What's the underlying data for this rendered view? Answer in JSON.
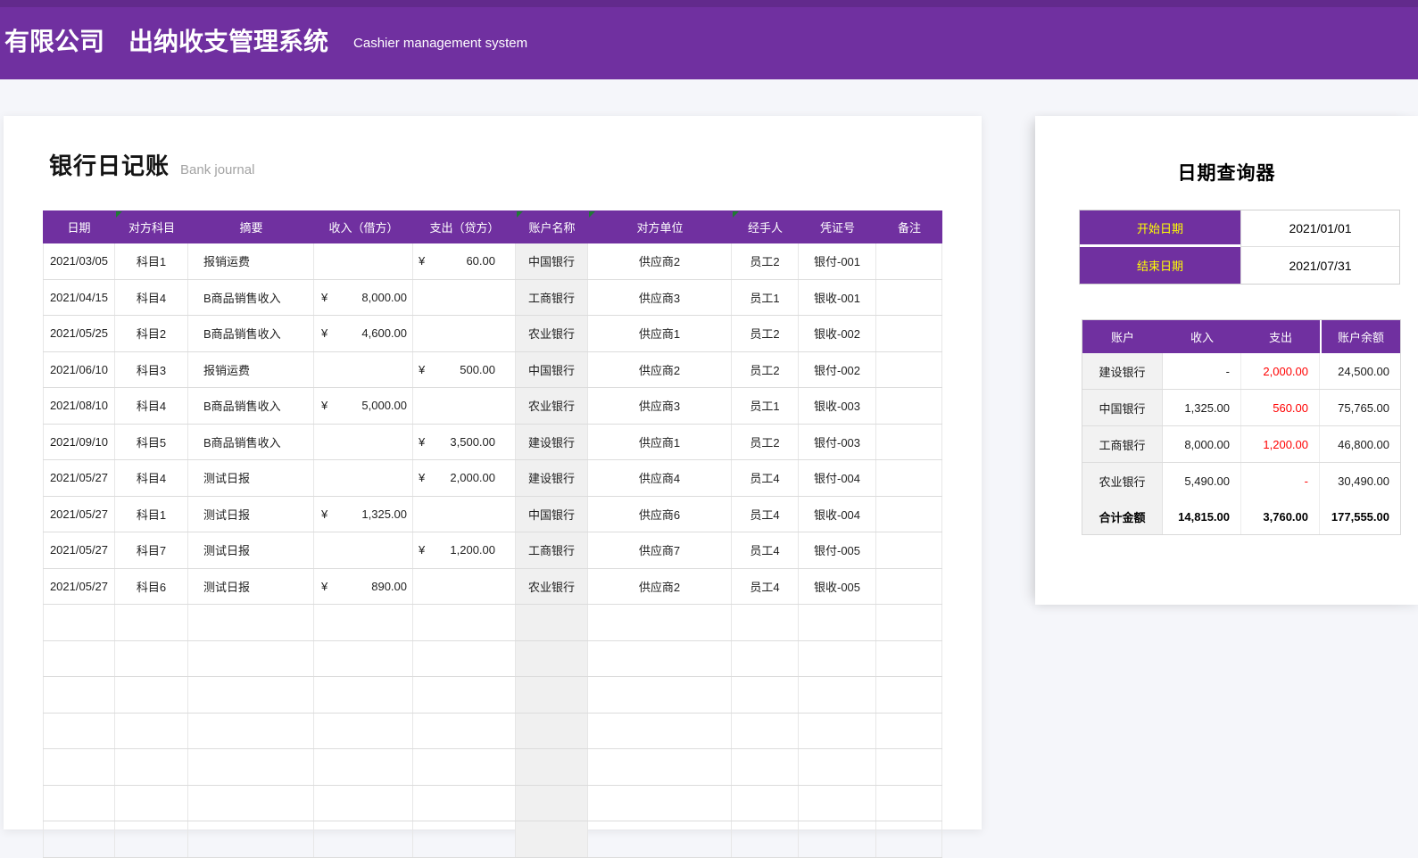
{
  "banner": {
    "company": "有限公司",
    "title": "出纳收支管理系统",
    "subtitle": "Cashier management system"
  },
  "colors": {
    "accent_purple": "#7030A0",
    "label_yellow": "#FFFF00",
    "expense_red": "#FF0000",
    "account_column_gray": "#F0F0F0",
    "page_background": "#F5F6FA"
  },
  "journal": {
    "title": "银行日记账",
    "subtitle": "Bank journal",
    "currency_symbol": "¥",
    "columns": [
      "日期",
      "对方科目",
      "摘要",
      "收入（借方）",
      "支出（贷方）",
      "账户名称",
      "对方单位",
      "经手人",
      "凭证号",
      "备注"
    ],
    "comment_marker_columns": [
      1,
      5,
      6,
      7
    ],
    "rows": [
      {
        "date": "2021/03/05",
        "subject": "科目1",
        "summary": "报销运费",
        "income": "",
        "expense": "60.00",
        "account": "中国银行",
        "counterparty": "供应商2",
        "handler": "员工2",
        "voucher": "银付-001",
        "note": ""
      },
      {
        "date": "2021/04/15",
        "subject": "科目4",
        "summary": "B商品销售收入",
        "income": "8,000.00",
        "expense": "",
        "account": "工商银行",
        "counterparty": "供应商3",
        "handler": "员工1",
        "voucher": "银收-001",
        "note": ""
      },
      {
        "date": "2021/05/25",
        "subject": "科目2",
        "summary": "B商品销售收入",
        "income": "4,600.00",
        "expense": "",
        "account": "农业银行",
        "counterparty": "供应商1",
        "handler": "员工2",
        "voucher": "银收-002",
        "note": ""
      },
      {
        "date": "2021/06/10",
        "subject": "科目3",
        "summary": "报销运费",
        "income": "",
        "expense": "500.00",
        "account": "中国银行",
        "counterparty": "供应商2",
        "handler": "员工2",
        "voucher": "银付-002",
        "note": ""
      },
      {
        "date": "2021/08/10",
        "subject": "科目4",
        "summary": "B商品销售收入",
        "income": "5,000.00",
        "expense": "",
        "account": "农业银行",
        "counterparty": "供应商3",
        "handler": "员工1",
        "voucher": "银收-003",
        "note": ""
      },
      {
        "date": "2021/09/10",
        "subject": "科目5",
        "summary": "B商品销售收入",
        "income": "",
        "expense": "3,500.00",
        "account": "建设银行",
        "counterparty": "供应商1",
        "handler": "员工2",
        "voucher": "银付-003",
        "note": ""
      },
      {
        "date": "2021/05/27",
        "subject": "科目4",
        "summary": "测试日报",
        "income": "",
        "expense": "2,000.00",
        "account": "建设银行",
        "counterparty": "供应商4",
        "handler": "员工4",
        "voucher": "银付-004",
        "note": ""
      },
      {
        "date": "2021/05/27",
        "subject": "科目1",
        "summary": "测试日报",
        "income": "1,325.00",
        "expense": "",
        "account": "中国银行",
        "counterparty": "供应商6",
        "handler": "员工4",
        "voucher": "银收-004",
        "note": ""
      },
      {
        "date": "2021/05/27",
        "subject": "科目7",
        "summary": "测试日报",
        "income": "",
        "expense": "1,200.00",
        "account": "工商银行",
        "counterparty": "供应商7",
        "handler": "员工4",
        "voucher": "银付-005",
        "note": ""
      },
      {
        "date": "2021/05/27",
        "subject": "科目6",
        "summary": "测试日报",
        "income": "890.00",
        "expense": "",
        "account": "农业银行",
        "counterparty": "供应商2",
        "handler": "员工4",
        "voucher": "银收-005",
        "note": ""
      }
    ],
    "empty_row_count": 7
  },
  "query": {
    "title": "日期查询器",
    "start_label": "开始日期",
    "start_value": "2021/01/01",
    "end_label": "结束日期",
    "end_value": "2021/07/31",
    "summary": {
      "columns": [
        "账户",
        "收入",
        "支出",
        "账户余额"
      ],
      "rows": [
        {
          "acct": "建设银行",
          "income": "-",
          "expense": "2,000.00",
          "balance": "24,500.00"
        },
        {
          "acct": "中国银行",
          "income": "1,325.00",
          "expense": "560.00",
          "balance": "75,765.00"
        },
        {
          "acct": "工商银行",
          "income": "8,000.00",
          "expense": "1,200.00",
          "balance": "46,800.00"
        },
        {
          "acct": "农业银行",
          "income": "5,490.00",
          "expense": "-",
          "balance": "30,490.00"
        }
      ],
      "total": {
        "acct": "合计金额",
        "income": "14,815.00",
        "expense": "3,760.00",
        "balance": "177,555.00"
      }
    }
  }
}
